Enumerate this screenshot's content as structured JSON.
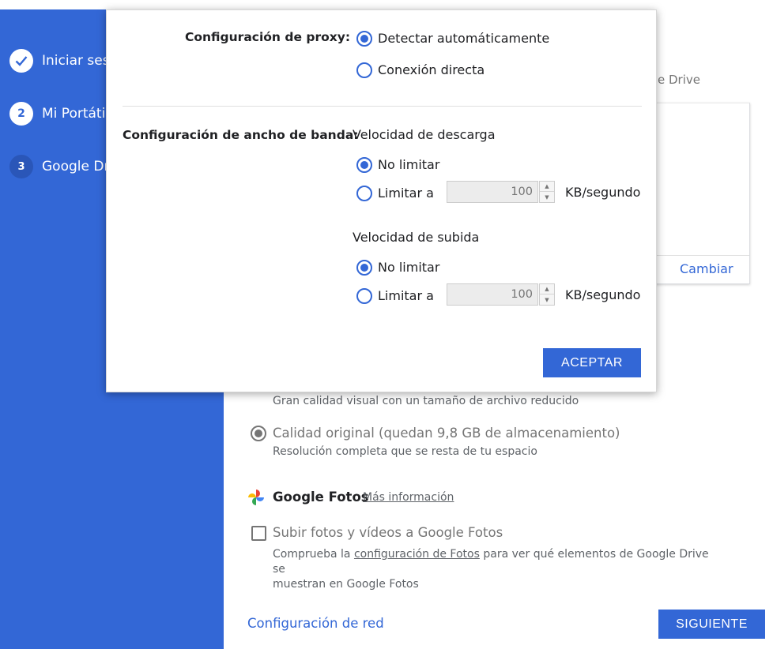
{
  "sidebar": {
    "steps": [
      {
        "number": "",
        "label": "Iniciar sesión",
        "state": "done"
      },
      {
        "number": "2",
        "label": "Mi Portátil",
        "state": "current"
      },
      {
        "number": "3",
        "label": "Google Drive",
        "state": "pending"
      }
    ]
  },
  "background": {
    "drive_text": "e Drive",
    "card_link": "Cambiar",
    "option_high_quality_desc": "Gran calidad visual con un tamaño de archivo reducido",
    "option_original_label": "Calidad original (quedan 9,8 GB de almacenamiento)",
    "option_original_desc": "Resolución completa que se resta de tu espacio",
    "fotos_title": "Google Fotos",
    "fotos_more_info": "Más información",
    "upload_checkbox_label": "Subir fotos y vídeos a Google Fotos",
    "upload_desc_prefix": "Comprueba la ",
    "upload_desc_link": "configuración de Fotos",
    "upload_desc_line1_suffix": " para ver qué elementos de Google Drive se",
    "upload_desc_line2": "muestran en Google Fotos",
    "network_link": "Configuración de red",
    "next_button": "SIGUIENTE"
  },
  "dialog": {
    "proxy": {
      "heading": "Configuración de proxy:",
      "options": [
        "Detectar automáticamente",
        "Conexión directa"
      ],
      "selected": "Detectar automáticamente"
    },
    "bandwidth": {
      "heading": "Configuración de ancho de banda:",
      "download": {
        "title": "Velocidad de descarga",
        "no_limit_label": "No limitar",
        "limit_label": "Limitar a",
        "value": "100",
        "unit": "KB/segundo",
        "selected": "No limitar"
      },
      "upload": {
        "title": "Velocidad de subida",
        "no_limit_label": "No limitar",
        "limit_label": "Limitar a",
        "value": "100",
        "unit": "KB/segundo",
        "selected": "No limitar"
      }
    },
    "accept_button": "ACEPTAR"
  },
  "colors": {
    "accent": "#3367d6",
    "sidebar": "#3367d6",
    "disabled_text": "#757575"
  }
}
